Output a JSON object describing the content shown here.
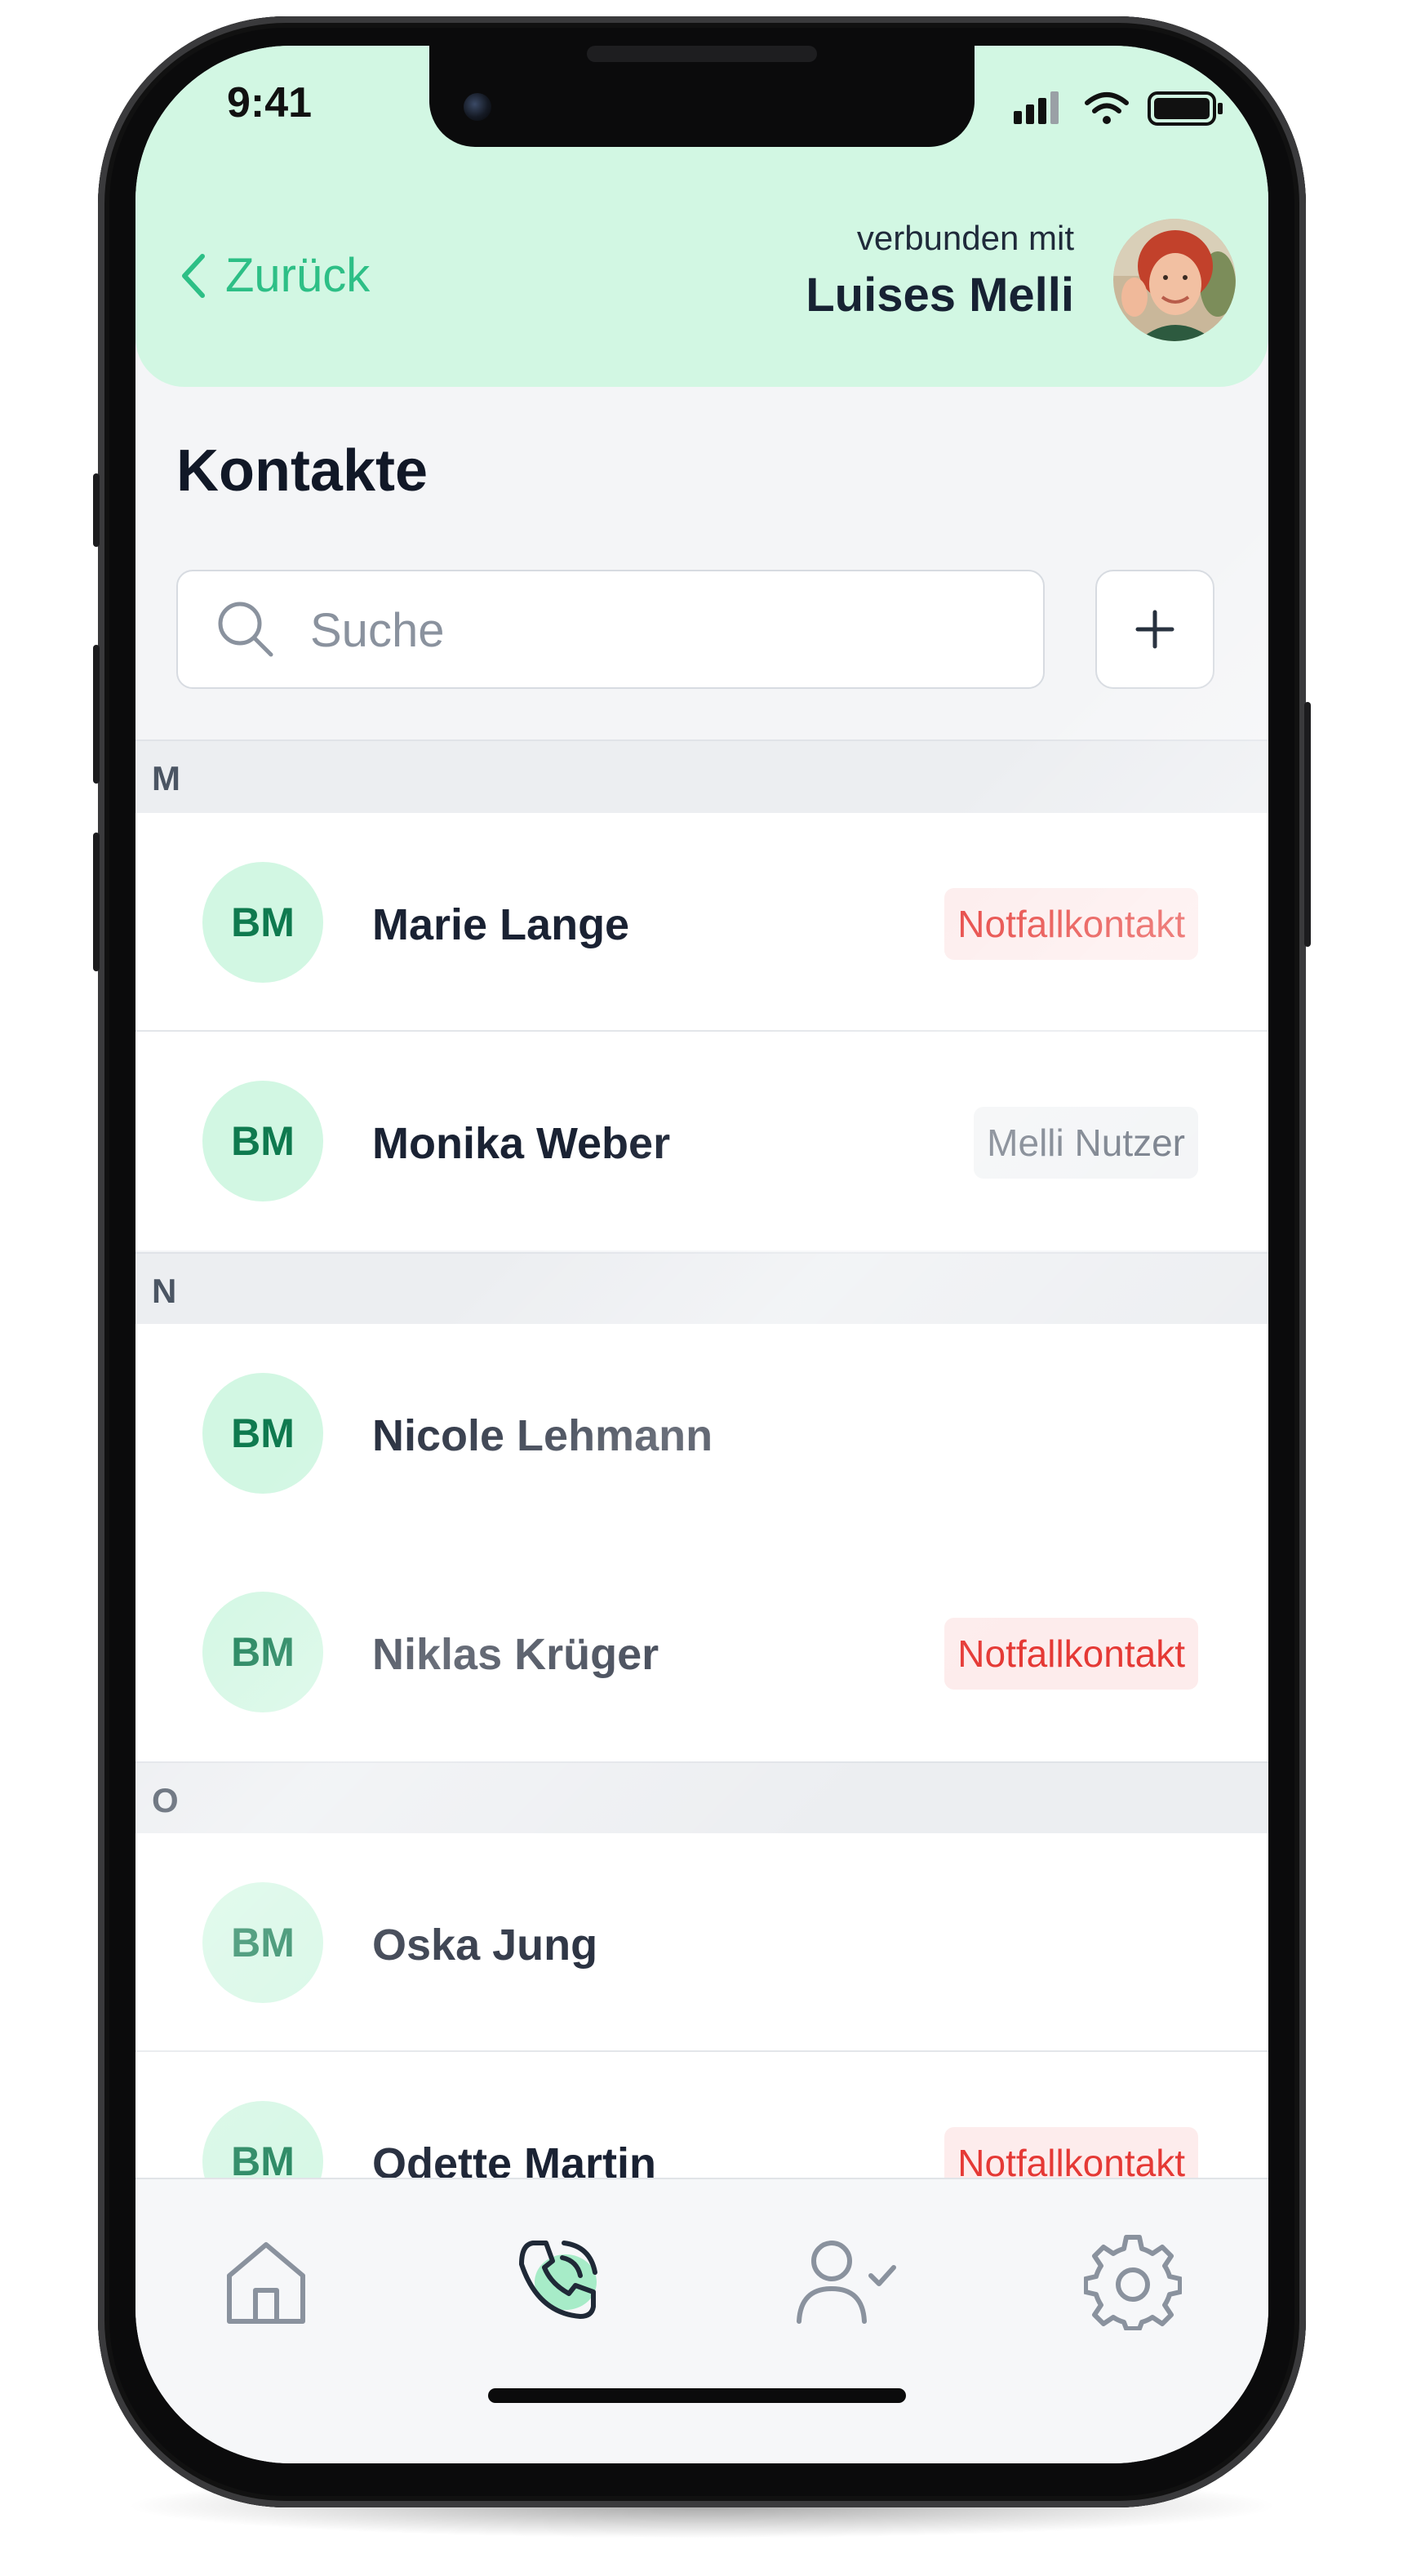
{
  "status_bar": {
    "time": "9:41"
  },
  "header": {
    "back_label": "Zurück",
    "connected_caption": "verbunden mit",
    "connected_name": "Luises Melli"
  },
  "page": {
    "title": "Kontakte"
  },
  "search": {
    "placeholder": "Suche",
    "value": ""
  },
  "sections": [
    {
      "letter": "M",
      "contacts": [
        {
          "initials": "BM",
          "name": "Marie Lange",
          "badge": "Notfallkontakt",
          "badge_type": "emergency"
        },
        {
          "initials": "BM",
          "name": "Monika Weber",
          "badge": "Melli Nutzer",
          "badge_type": "user"
        }
      ]
    },
    {
      "letter": "N",
      "contacts": [
        {
          "initials": "BM",
          "name": "Nicole Lehmann",
          "badge": "",
          "badge_type": ""
        },
        {
          "initials": "BM",
          "name": "Niklas Krüger",
          "badge": "Notfallkontakt",
          "badge_type": "emergency"
        }
      ]
    },
    {
      "letter": "O",
      "contacts": [
        {
          "initials": "BM",
          "name": "Oska Jung",
          "badge": "",
          "badge_type": ""
        },
        {
          "initials": "BM",
          "name": "Odette Martin",
          "badge": "Notfallkontakt",
          "badge_type": "emergency"
        }
      ]
    }
  ],
  "tab_bar": {
    "items": [
      {
        "icon": "home-icon",
        "active": false
      },
      {
        "icon": "phone-call-icon",
        "active": true
      },
      {
        "icon": "user-check-icon",
        "active": false
      },
      {
        "icon": "gear-icon",
        "active": false
      }
    ]
  },
  "colors": {
    "accent": "#2dbf86",
    "header_bg": "#d2f7e3",
    "avatar_text": "#0f7a4f",
    "emergency": "#e53935",
    "emergency_bg": "#fdecec"
  }
}
